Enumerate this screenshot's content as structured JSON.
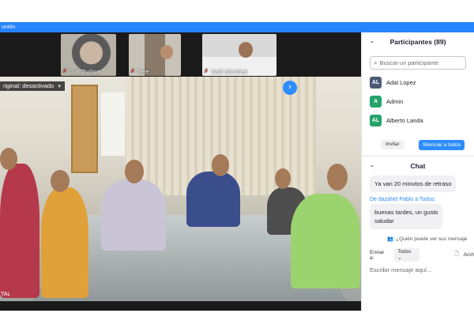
{
  "window": {
    "title": "unión"
  },
  "thumbnails": [
    {
      "name": "Luis Zuñiga",
      "muted": true
    },
    {
      "name": "Tere",
      "muted": true
    },
    {
      "name": "Saúl Sánchez",
      "muted": true
    }
  ],
  "main": {
    "original_sound_label": "riginal: desactivado",
    "bottom_label": "TAL"
  },
  "participants": {
    "title": "Participantes (89)",
    "search_placeholder": "Buscar un participante",
    "items": [
      {
        "initials": "AL",
        "name": "Adal Lopez",
        "color": "#4a5a78"
      },
      {
        "initials": "A",
        "name": "Admin",
        "color": "#24a36b"
      },
      {
        "initials": "AL",
        "name": "Alberto Landa",
        "color": "#24a36b"
      }
    ],
    "invite_label": "Invitar",
    "mute_all_label": "Silenciar a todos"
  },
  "chat": {
    "title": "Chat",
    "messages_top": "Ya van 20 minutos de retraso",
    "from_label": "De dazahel Pablo a Todos:",
    "message_body_line1": "buenas tardes, un gusto",
    "message_body_line2": "saludar",
    "who_can_see": "¿Quién puede ver sus mensaje",
    "send_to_label": "Enviar a:",
    "send_to_value": "Todos",
    "file_label": "Arch",
    "input_placeholder": "Escribir mensaje aquí..."
  }
}
